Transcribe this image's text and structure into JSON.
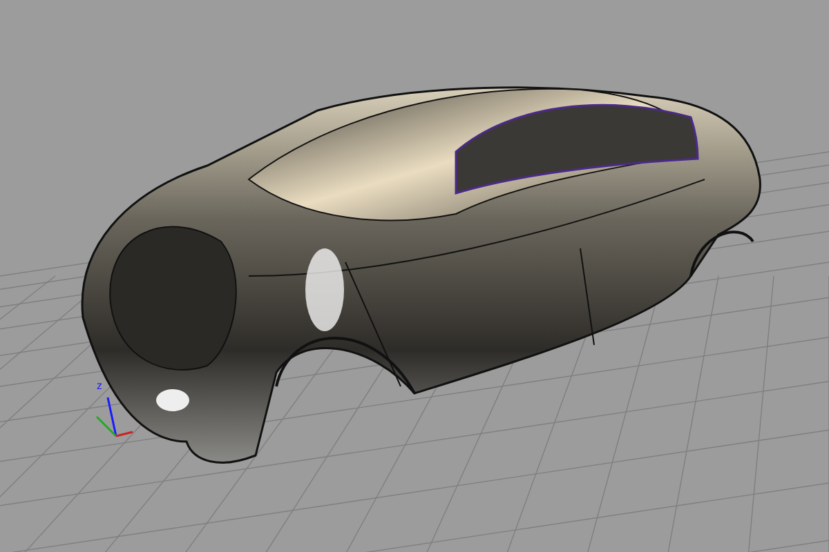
{
  "viewport": {
    "axes": [
      {
        "kind": "z",
        "label": "z",
        "color": "#1a1aff"
      },
      {
        "kind": "y",
        "color": "#22aa22"
      },
      {
        "kind": "x",
        "color": "#cc2222"
      }
    ]
  }
}
